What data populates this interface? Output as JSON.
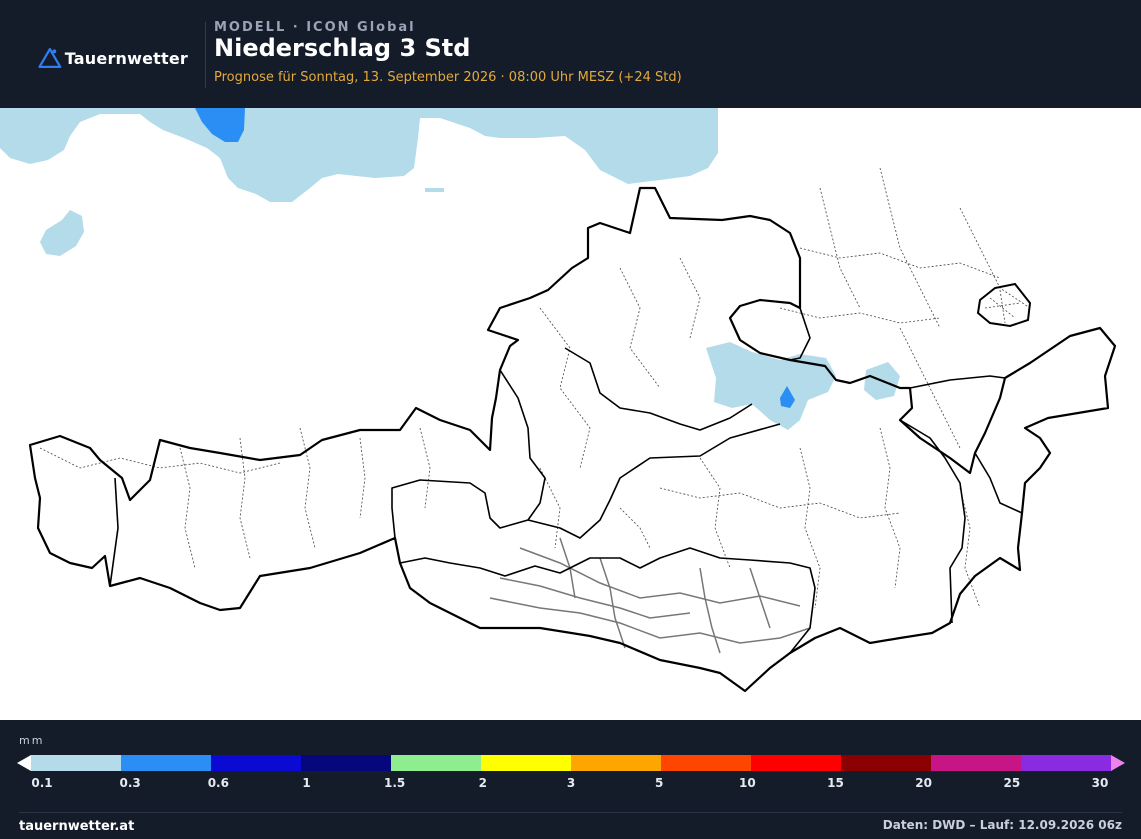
{
  "header": {
    "logo_text": "Tauernwetter",
    "model_label": "MODELL · ICON Global",
    "title": "Niederschlag 3 Std",
    "forecast": "Prognose für Sonntag, 13. September 2026 · 08:00 Uhr MESZ  (+24 Std)"
  },
  "colors": {
    "background": "#141c2a",
    "accent": "#e5a93a",
    "logo": "#2f7cf6"
  },
  "legend": {
    "unit": "mm",
    "bins": [
      {
        "from": "0.1",
        "to": "0.3",
        "color": "#b4dbe9"
      },
      {
        "from": "0.3",
        "to": "0.6",
        "color": "#2a8ef5"
      },
      {
        "from": "0.6",
        "to": "1",
        "color": "#0a0ad2"
      },
      {
        "from": "1",
        "to": "1.5",
        "color": "#06067d"
      },
      {
        "from": "1.5",
        "to": "2",
        "color": "#8eed8e"
      },
      {
        "from": "2",
        "to": "3",
        "color": "#ffff00"
      },
      {
        "from": "3",
        "to": "5",
        "color": "#ffa500"
      },
      {
        "from": "5",
        "to": "10",
        "color": "#ff4500"
      },
      {
        "from": "10",
        "to": "15",
        "color": "#ff0000"
      },
      {
        "from": "15",
        "to": "20",
        "color": "#8b0000"
      },
      {
        "from": "20",
        "to": "25",
        "color": "#c71585"
      },
      {
        "from": "25",
        "to": "30",
        "color": "#8a2be2"
      }
    ],
    "over_color": "#ee82ee",
    "under_color": "#ffffff",
    "ticks": [
      "0.1",
      "0.3",
      "0.6",
      "1",
      "1.5",
      "2",
      "3",
      "5",
      "10",
      "15",
      "20",
      "25",
      "30"
    ]
  },
  "footer": {
    "site": "tauernwetter.at",
    "source": "Daten: DWD – Lauf: 12.09.2026 06z"
  },
  "map": {
    "precip_color": "#b4dbe9",
    "precip_heavy_color": "#2a8ef5",
    "border_color": "#000000",
    "district_color": "#444444",
    "river_color": "#777777"
  }
}
